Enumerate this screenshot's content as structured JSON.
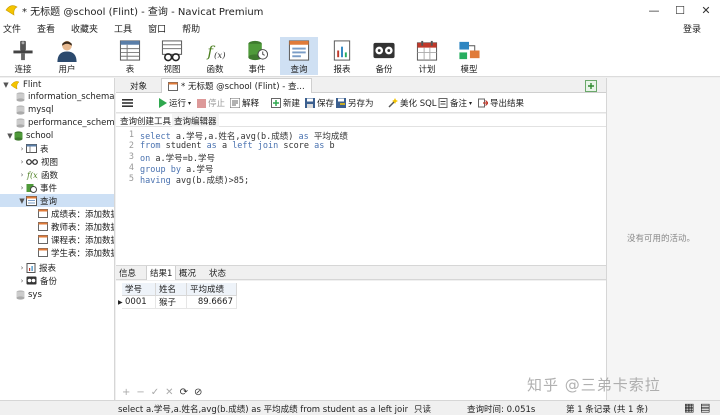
{
  "window": {
    "title": "* 无标题 @school (Flint) - 查询 - Navicat Premium",
    "controls": {
      "minimize": "—",
      "maximize": "☐",
      "close": "✕"
    }
  },
  "menu": [
    "文件",
    "查看",
    "收藏夹",
    "工具",
    "窗口",
    "帮助"
  ],
  "login_label": "登录",
  "toolbar": [
    {
      "label": "连接",
      "icon": "connection-icon"
    },
    {
      "label": "用户",
      "icon": "user-icon"
    },
    {
      "label": "表",
      "icon": "table-icon"
    },
    {
      "label": "视图",
      "icon": "view-icon"
    },
    {
      "label": "函数",
      "icon": "function-icon"
    },
    {
      "label": "事件",
      "icon": "event-icon"
    },
    {
      "label": "查询",
      "icon": "query-icon"
    },
    {
      "label": "报表",
      "icon": "report-icon"
    },
    {
      "label": "备份",
      "icon": "backup-icon"
    },
    {
      "label": "计划",
      "icon": "schedule-icon"
    },
    {
      "label": "模型",
      "icon": "model-icon"
    }
  ],
  "sidebar": {
    "connection": "Flint",
    "databases": [
      "information_schema",
      "mysql",
      "performance_schema"
    ],
    "school": {
      "name": "school",
      "children": [
        "表",
        "视图",
        "函数",
        "事件",
        "查询"
      ],
      "queries": [
        "成绩表：添加数据",
        "教师表：添加数据",
        "课程表：添加数据",
        "学生表：添加数据"
      ],
      "after": [
        "报表",
        "备份"
      ]
    },
    "sys": "sys"
  },
  "tabs": {
    "objects": "对象",
    "query": "* 无标题 @school (Flint) - 查..."
  },
  "query_toolbar": {
    "run": "运行",
    "stop": "停止",
    "explain": "解释",
    "new": "新建",
    "save": "保存",
    "save_as": "另存为",
    "beautify": "美化 SQL",
    "comment": "备注",
    "export": "导出结果"
  },
  "subtabs": [
    "查询创建工具",
    "查询编辑器"
  ],
  "editor": {
    "line_numbers": [
      "1",
      "2",
      "3",
      "4",
      "5"
    ],
    "lines": [
      "select a.学号,a.姓名,avg(b.成绩) as 平均成绩",
      "from student as a left join score as b",
      "on a.学号=b.学号",
      "group by a.学号",
      "having avg(b.成绩)>85;"
    ]
  },
  "result_tabs": [
    "信息",
    "结果1",
    "概况",
    "状态"
  ],
  "grid": {
    "columns": [
      "学号",
      "姓名",
      "平均成绩"
    ],
    "rows": [
      [
        "0001",
        "猴子",
        "89.6667"
      ]
    ]
  },
  "right_panel": {
    "no_activity": "没有可用的活动。"
  },
  "status": {
    "sql": "select a.学号,a.姓名,avg(b.成绩) as 平均成绩 from student as a left join score",
    "mode": "只读",
    "time": "查询时间: 0.051s",
    "records": "第 1 条记录 (共 1 条)"
  },
  "watermark": "知乎 @三弟卡索拉",
  "colors": {
    "accent": "#cfe0f3",
    "selection": "#cde0f5",
    "keyword": "#4a72b0"
  }
}
